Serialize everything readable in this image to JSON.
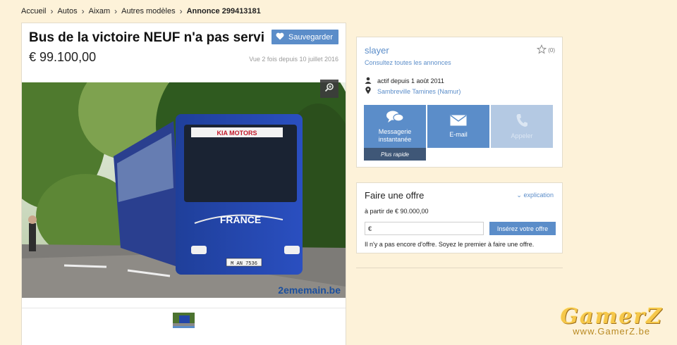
{
  "breadcrumb": {
    "items": [
      "Accueil",
      "Autos",
      "Aixam",
      "Autres modèles"
    ],
    "current": "Annonce 299413181",
    "separator": "›"
  },
  "listing": {
    "title": "Bus de la victoire NEUF n'a pas servi",
    "price": "€ 99.100,00",
    "save_label": "Sauvegarder",
    "views": "Vue 2 fois depuis 10 juillet 2016",
    "photo": {
      "bus_banner": "KIA MOTORS",
      "bus_side_text": "FRANCE",
      "plate": "M AN 7536",
      "watermark": "2ememain.be"
    }
  },
  "seller": {
    "name": "slayer",
    "all_ads_link": "Consultez toutes les annonces",
    "favorite_count": "(0)",
    "active_since": "actif depuis 1 août 2011",
    "location": "Sambreville Tamines (Namur)",
    "contact_buttons": [
      {
        "label": "Messagerie instantanée",
        "icon": "chat-icon",
        "enabled": true
      },
      {
        "label": "E-mail",
        "icon": "envelope-icon",
        "enabled": true
      },
      {
        "label": "Appeler",
        "icon": "phone-icon",
        "enabled": false
      }
    ],
    "fast_badge": "Plus rapide"
  },
  "offer": {
    "title": "Faire une offre",
    "explain_link": "explication",
    "min_price": "à partir de € 90.000,00",
    "currency_prefix": "€",
    "submit_label": "Insérez votre offre",
    "no_offer_text": "Il n'y a pas encore d'offre. Soyez le premier à faire une offre."
  },
  "watermark": {
    "logo": "GamerZ",
    "url": "www.GamerZ.be"
  },
  "colors": {
    "accent": "#5b8dc9",
    "page_bg": "#fdf2d9",
    "fast_badge": "#3f5777",
    "watermark_gold": "#f6c84a"
  }
}
